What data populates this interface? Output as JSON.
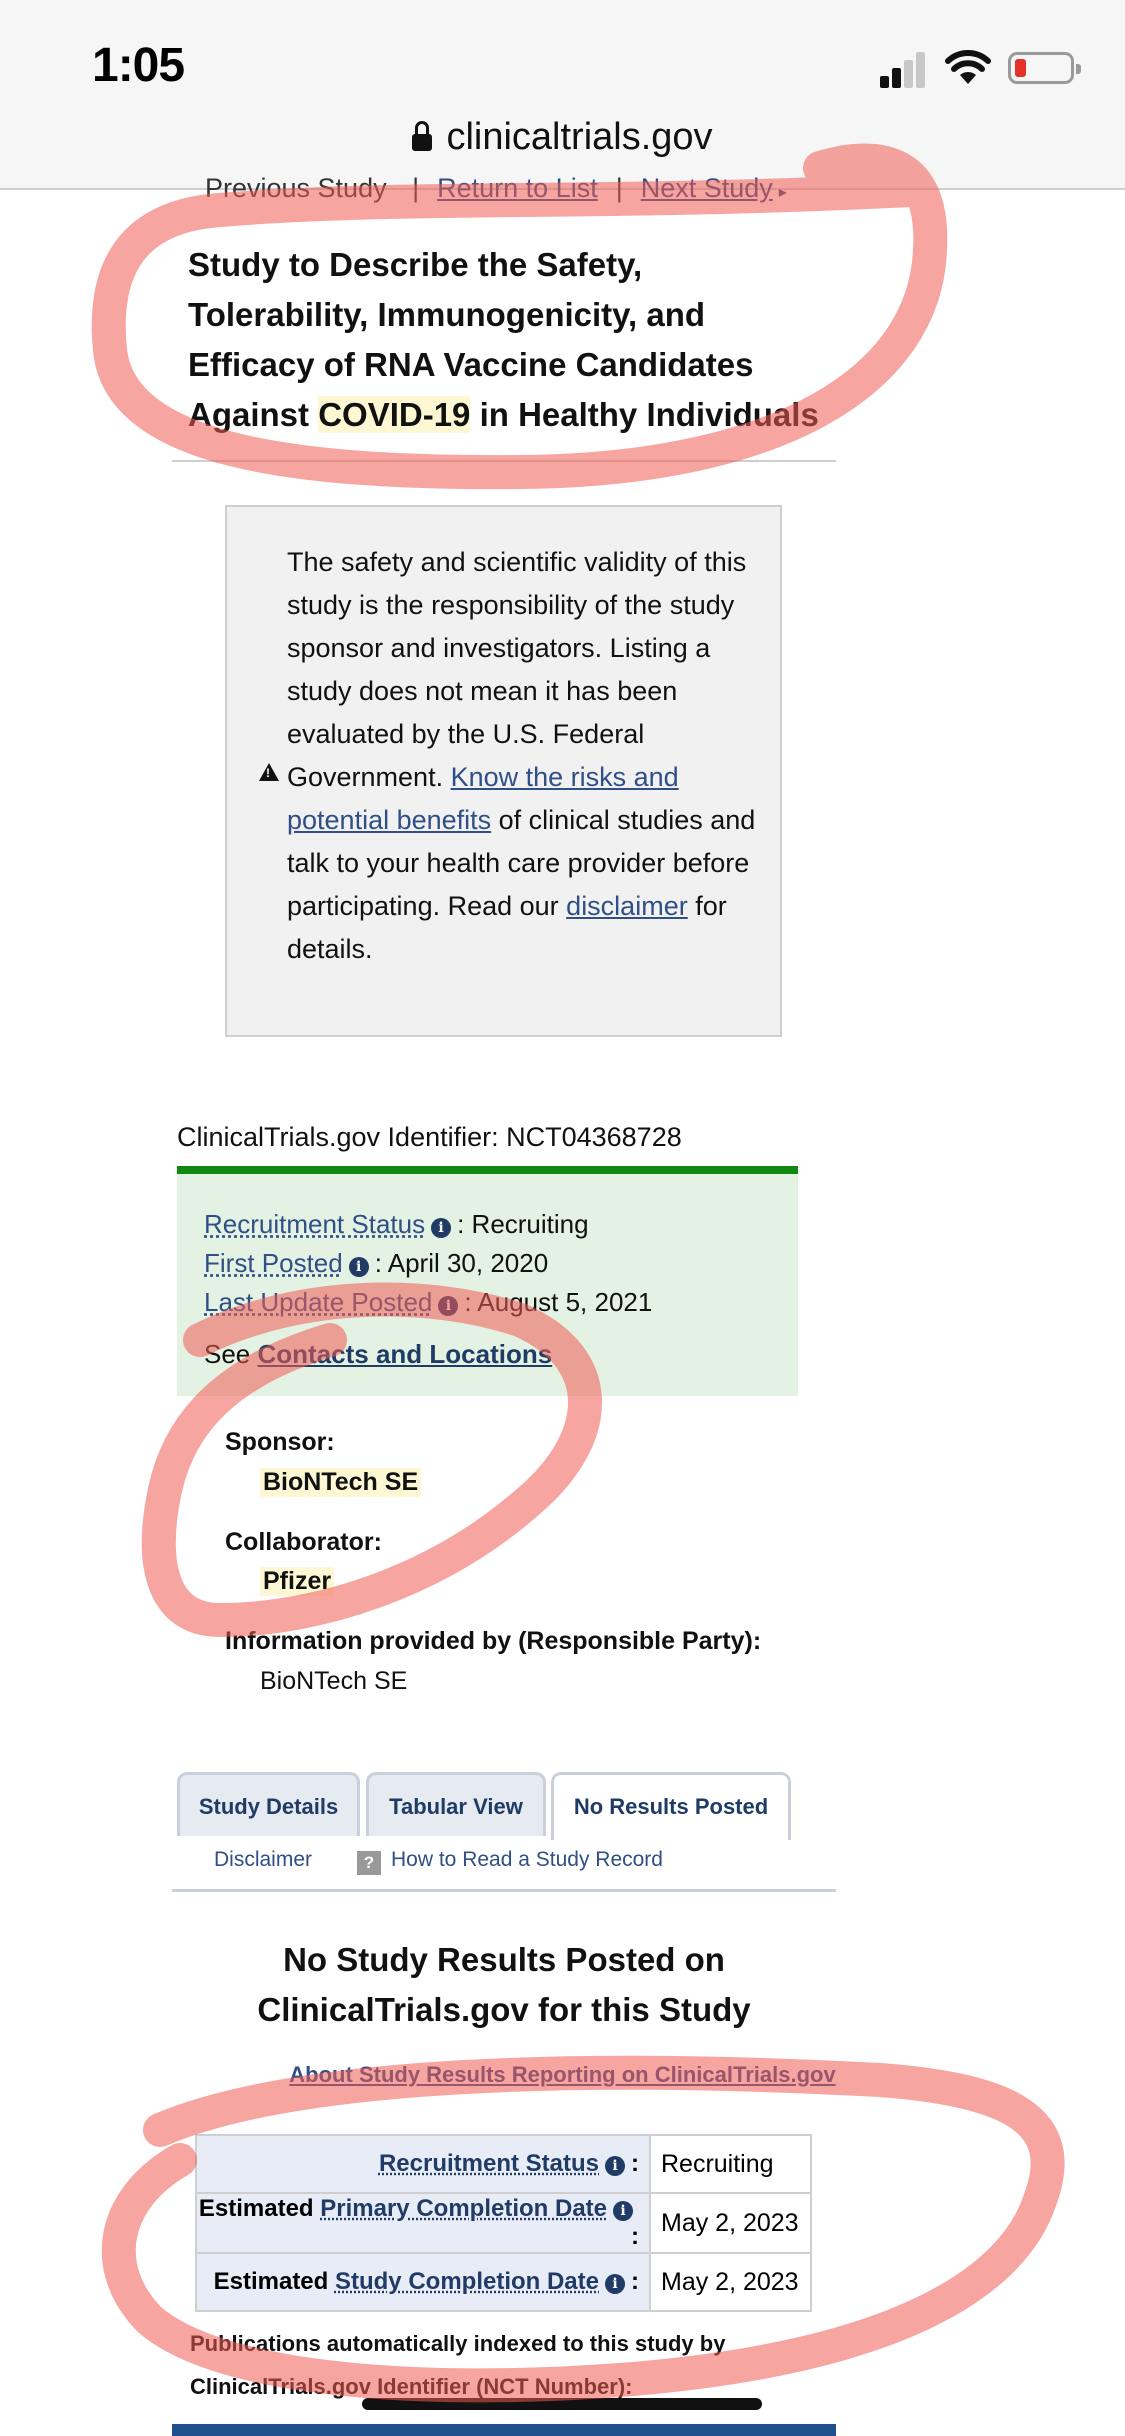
{
  "status_bar": {
    "time": "1:05"
  },
  "url_bar": {
    "domain": "clinicaltrials.gov"
  },
  "study_nav": {
    "previous": "Previous Study",
    "separator": "|",
    "return": "Return to List",
    "next": "Next Study"
  },
  "title": {
    "part1": "Study to Describe the Safety, Tolerability, Immunogenicity, and Efficacy of RNA Vaccine Candidates Against ",
    "highlight": "COVID-19",
    "part2": " in Healthy Individuals"
  },
  "disclaimer": {
    "text1": "The safety and scientific validity of this study is the responsibility of the study sponsor and investigators. Listing a study does not mean it has been evaluated by the U.S. Federal Government. ",
    "risks_link": "Know the risks and potential benefits",
    "text2": " of clinical studies and talk to your health care provider before participating. Read our ",
    "disclaimer_link": "disclaimer",
    "text3": " for details."
  },
  "identifier": "ClinicalTrials.gov Identifier: NCT04368728",
  "status": {
    "recruitment_label": "Recruitment Status",
    "recruitment_value": ": Recruiting",
    "first_posted_label": "First Posted",
    "first_posted_value": ": April 30, 2020",
    "last_update_label": "Last Update Posted",
    "last_update_value": ": August 5, 2021",
    "see": "See",
    "contacts_link": "Contacts and Locations"
  },
  "sponsor": {
    "sponsor_label": "Sponsor:",
    "sponsor_value": "BioNTech SE",
    "collaborator_label": "Collaborator:",
    "collaborator_value": "Pfizer",
    "info_label": "Information provided by (Responsible Party):",
    "info_value": "BioNTech SE"
  },
  "tabs": [
    {
      "label": "Study Details"
    },
    {
      "label": "Tabular View"
    },
    {
      "label": "No Results Posted"
    }
  ],
  "sublinks": {
    "disclaimer": "Disclaimer",
    "how_to_read": "How to Read a Study Record"
  },
  "results": {
    "heading": "No Study Results Posted on ClinicalTrials.gov for this Study",
    "about_link": "About Study Results Reporting on ClinicalTrials.gov"
  },
  "stats_table": {
    "row1_link": "Recruitment Status",
    "row1_value": "Recruiting",
    "row2_prefix": "Estimated",
    "row2_link": "Primary Completion Date",
    "row2_value": "May 2, 2023",
    "row3_prefix": "Estimated",
    "row3_link": "Study Completion Date",
    "row3_value": "May 2, 2023",
    "colon": ":"
  },
  "publications": "Publications automatically indexed to this study by ClinicalTrials.gov Identifier (NCT Number):",
  "colors": {
    "accent_link": "#2f4f86",
    "status_green": "#118811",
    "status_bg": "#e4f2e3",
    "annotation_red": "#f05b54"
  }
}
